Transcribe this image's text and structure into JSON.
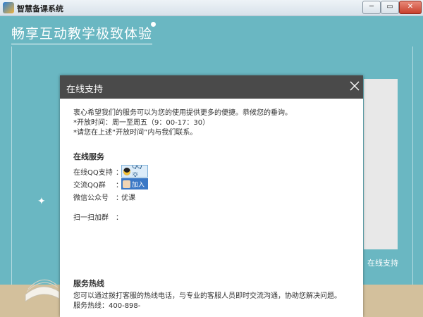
{
  "window": {
    "title": "智慧备课系统",
    "min_label": "─",
    "max_label": "▭",
    "close_label": "✕"
  },
  "background": {
    "slogan": "畅享互动教学极致体验",
    "right_panel_label": "在线支持"
  },
  "dialog": {
    "title": "在线支持",
    "intro": [
      "衷心希望我们的服务可以为您的使用提供更多的便捷。恭候您的垂询。",
      "*开放时间：周一至周五（9：00-17：30）",
      "*请您在上述“开放时间”内与我们联系。"
    ],
    "online_service": {
      "title": "在线服务",
      "rows": [
        {
          "label": "在线QQ支持",
          "colon": "：",
          "button": "QQ交"
        },
        {
          "label": "交流QQ群",
          "colon": "：",
          "button": "加入"
        },
        {
          "label": "微信公众号",
          "colon": "：",
          "value": "优课"
        },
        {
          "label": "扫一扫加群",
          "colon": "：",
          "value": ""
        }
      ]
    },
    "hotline": {
      "title": "服务热线",
      "description": "您可以通过拨打客服的热线电话，与专业的客服人员即时交流沟通，协助您解决问题。",
      "phone": "服务热线：400-898-"
    }
  },
  "colors": {
    "background": "#6ab7c2",
    "dialog_header": "#4a4a4a",
    "floor": "#d3c09c"
  }
}
